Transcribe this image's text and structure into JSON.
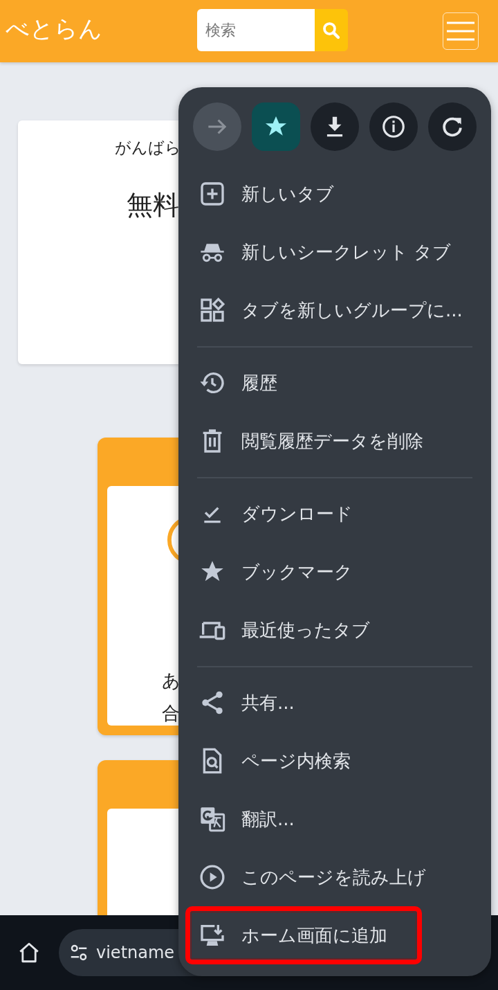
{
  "header": {
    "logo": "べとらん",
    "search": {
      "placeholder": "検索"
    }
  },
  "page": {
    "intro_card": {
      "lines": [
        "がんばら",
        "無料"
      ]
    },
    "feature_card": {
      "lines": [
        "あ",
        "合"
      ]
    }
  },
  "address_bar": {
    "url": "vietname"
  },
  "menu": {
    "top_actions": [
      {
        "disabled": true,
        "selected": false
      },
      {
        "disabled": false,
        "selected": true
      },
      {
        "disabled": false,
        "selected": false
      },
      {
        "disabled": false,
        "selected": false
      },
      {
        "disabled": false,
        "selected": false
      }
    ],
    "groups": [
      {
        "items": [
          {
            "label": "新しいタブ",
            "highlighted": false
          },
          {
            "label": "新しいシークレット タブ",
            "highlighted": false
          },
          {
            "label": "タブを新しいグループに...",
            "highlighted": false
          }
        ]
      },
      {
        "items": [
          {
            "label": "履歴",
            "highlighted": false
          },
          {
            "label": "閲覧履歴データを削除",
            "highlighted": false
          }
        ]
      },
      {
        "items": [
          {
            "label": "ダウンロード",
            "highlighted": false
          },
          {
            "label": "ブックマーク",
            "highlighted": false
          },
          {
            "label": "最近使ったタブ",
            "highlighted": false
          }
        ]
      },
      {
        "items": [
          {
            "label": "共有...",
            "highlighted": false
          },
          {
            "label": "ページ内検索",
            "highlighted": false
          },
          {
            "label": "翻訳...",
            "highlighted": false
          },
          {
            "label": "このページを読み上げ",
            "highlighted": false
          },
          {
            "label": "ホーム画面に追加",
            "highlighted": true
          }
        ]
      }
    ]
  }
}
